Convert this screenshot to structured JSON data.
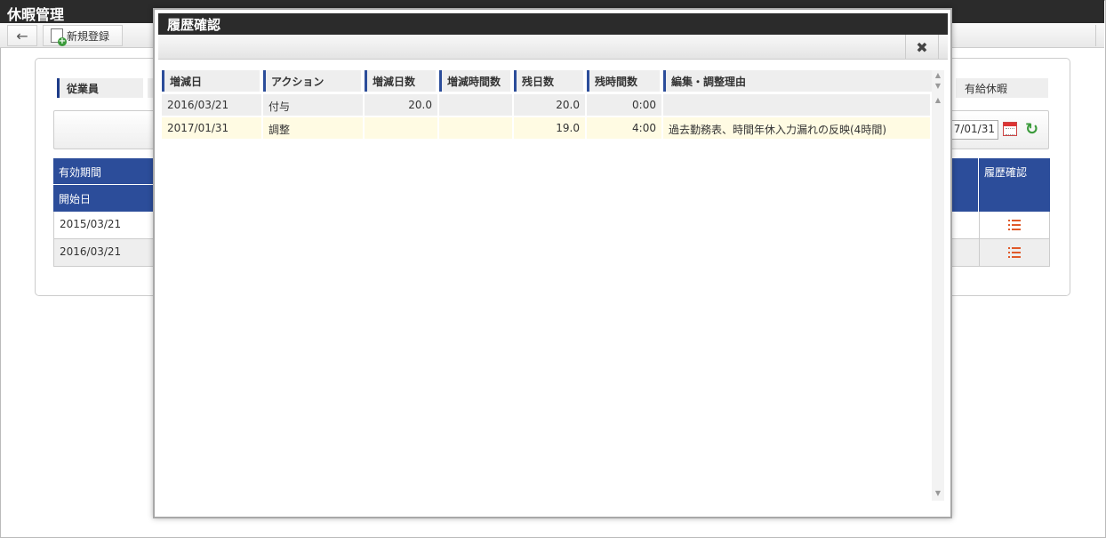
{
  "app": {
    "title": "休暇管理",
    "new_button_label": "新規登録",
    "back_icon": "arrow-left-icon"
  },
  "panel": {
    "employee_label": "従業員",
    "leave_type": "有給休暇",
    "date_value": "7/01/31"
  },
  "bg_table": {
    "head_period": "有効期間",
    "head_start": "開始日",
    "head_history": "履歴確認",
    "rows": [
      {
        "start": "2015/03/21"
      },
      {
        "start": "2016/03/21"
      }
    ]
  },
  "modal": {
    "title": "履歴確認",
    "close_icon": "close-icon",
    "columns": [
      "増減日",
      "アクション",
      "増減日数",
      "増減時間数",
      "残日数",
      "残時間数",
      "編集・調整理由"
    ],
    "rows": [
      {
        "date": "2016/03/21",
        "action": "付与",
        "change_days": "20.0",
        "change_hours": "",
        "remain_days": "20.0",
        "remain_hours": "0:00",
        "reason": ""
      },
      {
        "date": "2017/01/31",
        "action": "調整",
        "change_days": "",
        "change_hours": "",
        "remain_days": "19.0",
        "remain_hours": "4:00",
        "reason": "過去勤務表、時間年休入力漏れの反映(4時間)"
      }
    ]
  },
  "colors": {
    "header_dark": "#2b2b2b",
    "accent_blue": "#2c4d9a",
    "highlight_row": "#fffbe3",
    "list_icon": "#e05a2a",
    "refresh": "#3a9a3a"
  }
}
